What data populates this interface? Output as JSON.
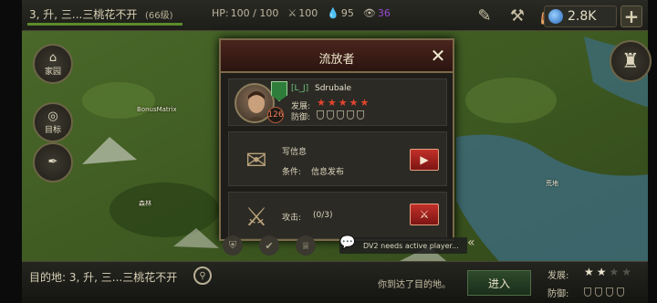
{
  "topbar": {
    "location_title": "3, 升, 三...三桃花不开",
    "level": "(66级)",
    "xp_fraction": 1.0,
    "hp_label": "HP:",
    "hp_value": "100 / 100",
    "attack_value": "100",
    "food_value": "95",
    "vision_value": "36",
    "gem_count": "2.8K",
    "plus_label": "+"
  },
  "left_menu": {
    "home_label": "家园",
    "target_label": "目标"
  },
  "map_labels": {
    "forest_label": "森林",
    "village_label": "荒地",
    "player_tag": "BonusMatrix"
  },
  "dialog": {
    "title": "流放者",
    "close_label": "✕",
    "player": {
      "guild": "[L_J]",
      "name": "Sdrubale",
      "level": "126",
      "development_label": "发展:",
      "development_stars": 5,
      "defense_label": "防御:",
      "defense_shields": 5
    },
    "message_row": {
      "title": "写信息",
      "condition_label": "条件:",
      "condition_value": "信息发布"
    },
    "attack_row": {
      "label": "攻击:",
      "value": "(0/3)"
    }
  },
  "chat": {
    "message": "DV2 needs active player..."
  },
  "bottombar": {
    "destination": "目的地: 3, 升, 三...三桃花不开",
    "arrived_text": "你到达了目的地。",
    "enter_label": "进入",
    "development_label": "发展:",
    "development_stars": 2,
    "development_max": 4,
    "defense_label": "防御:",
    "defense_shields": 4
  },
  "colors": {
    "accent_red": "#c2302a",
    "star_red": "#e2452e",
    "guild_green": "#6fc47a",
    "vision_purple": "#9a4bd1"
  }
}
